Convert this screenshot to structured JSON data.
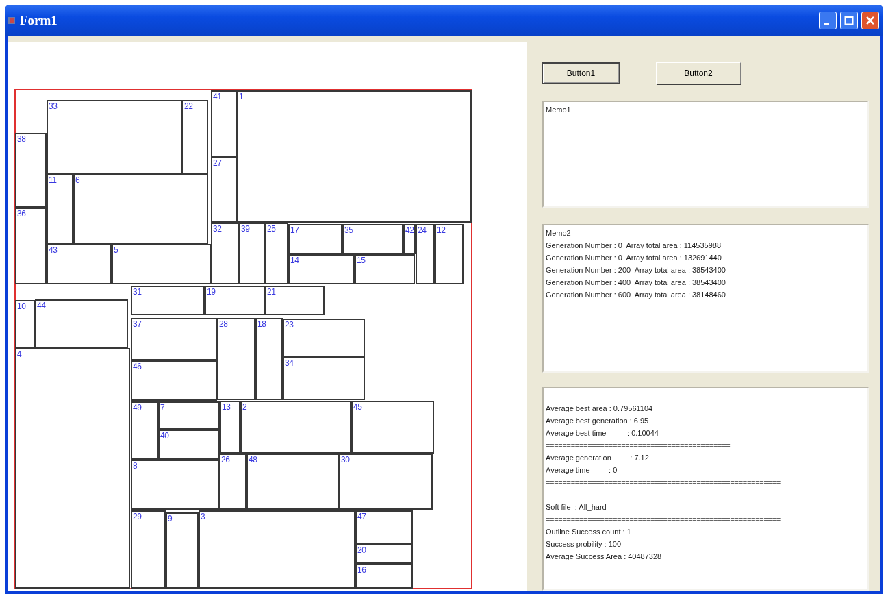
{
  "window": {
    "title": "Form1"
  },
  "layout": {
    "blocks": [
      {
        "label": "33"
      },
      {
        "label": "22"
      },
      {
        "label": "38"
      },
      {
        "label": "36"
      },
      {
        "label": "11"
      },
      {
        "label": "6"
      },
      {
        "label": "43"
      },
      {
        "label": "5"
      },
      {
        "label": "41"
      },
      {
        "label": "27"
      },
      {
        "label": "1"
      },
      {
        "label": "32"
      },
      {
        "label": "39"
      },
      {
        "label": "25"
      },
      {
        "label": "17"
      },
      {
        "label": "35"
      },
      {
        "label": "42"
      },
      {
        "label": "14"
      },
      {
        "label": "15"
      },
      {
        "label": "24"
      },
      {
        "label": "12"
      },
      {
        "label": "31"
      },
      {
        "label": "19"
      },
      {
        "label": "21"
      },
      {
        "label": "10"
      },
      {
        "label": "44"
      },
      {
        "label": "4"
      },
      {
        "label": "37"
      },
      {
        "label": "46"
      },
      {
        "label": "28"
      },
      {
        "label": "18"
      },
      {
        "label": "23"
      },
      {
        "label": "34"
      },
      {
        "label": "49"
      },
      {
        "label": "7"
      },
      {
        "label": "40"
      },
      {
        "label": "13"
      },
      {
        "label": "2"
      },
      {
        "label": "45"
      },
      {
        "label": "8"
      },
      {
        "label": "26"
      },
      {
        "label": "48"
      },
      {
        "label": "30"
      },
      {
        "label": "29"
      },
      {
        "label": "9"
      },
      {
        "label": "3"
      },
      {
        "label": "47"
      },
      {
        "label": "20"
      },
      {
        "label": "16"
      }
    ]
  },
  "buttons": [
    {
      "label": "Button1",
      "focused": true
    },
    {
      "label": "Button2",
      "focused": false
    }
  ],
  "memos": [
    {
      "lines": [
        {
          "kind": "text",
          "text": "Memo1"
        }
      ]
    },
    {
      "lines": [
        {
          "kind": "text",
          "text": "Memo2"
        },
        {
          "kind": "text",
          "text": "Generation Number : 0  Array total area : 114535988"
        },
        {
          "kind": "text",
          "text": "Generation Number : 0  Array total area : 132691440"
        },
        {
          "kind": "text",
          "text": "Generation Number : 200  Array total area : 38543400"
        },
        {
          "kind": "text",
          "text": "Generation Number : 400  Array total area : 38543400"
        },
        {
          "kind": "text",
          "text": "Generation Number : 600  Array total area : 38148460"
        }
      ]
    },
    {
      "lines": [
        {
          "kind": "rule",
          "text": "---------------------------------------------------------"
        },
        {
          "kind": "text",
          "text": "Average best area : 0.79561104"
        },
        {
          "kind": "text",
          "text": "Average best generation : 6.95"
        },
        {
          "kind": "text",
          "text": "Average best time          : 0.10044"
        },
        {
          "kind": "rule",
          "text": "============================================"
        },
        {
          "kind": "text",
          "text": "Average generation         : 7.12"
        },
        {
          "kind": "text",
          "text": "Average time         : 0"
        },
        {
          "kind": "rule",
          "text": "========================================================"
        },
        {
          "kind": "blank"
        },
        {
          "kind": "text",
          "text": "Soft file  : All_hard"
        },
        {
          "kind": "rule",
          "text": "========================================================"
        },
        {
          "kind": "text",
          "text": "Outline Success count : 1"
        },
        {
          "kind": "text",
          "text": "Success probility : 100"
        },
        {
          "kind": "text",
          "text": "Average Success Area : 40487328"
        }
      ]
    }
  ]
}
